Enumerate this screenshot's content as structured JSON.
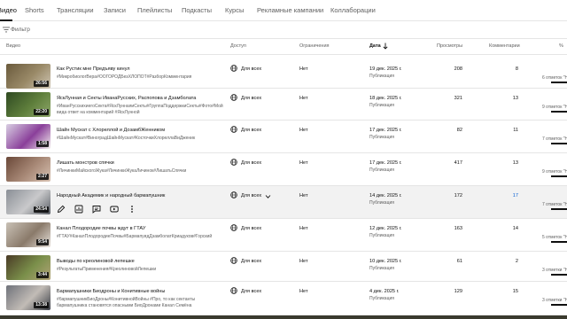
{
  "tabs": [
    "Видео",
    "Shorts",
    "Трансляции",
    "Записи",
    "Плейлисты",
    "Подкасты",
    "Курсы",
    "Рекламные кампании",
    "Коллаборации"
  ],
  "filter": {
    "label": "Фильтр",
    "icon": "filter-icon"
  },
  "columns": {
    "video": "Видео",
    "access": "Доступ",
    "restrictions": "Ограничения",
    "date": "Дата",
    "views": "Просмотры",
    "comments": "Комментарии",
    "likes": "% "
  },
  "rows": [
    {
      "title": "Как Рустик мне Предъяву кинул",
      "desc": "#МикробиологВера#ООГОРОДБезХЛОПОТ#РазборКомментария",
      "duration": "26:56",
      "access": "Для всех",
      "restrictions": "Нет",
      "date": "19 дек. 2025 г.",
      "status": "Публикация",
      "views": "208",
      "comments": "8",
      "likes": "6 отметок \"Н",
      "thumb_colors": [
        "#6a5a3c",
        "#9a8a68",
        "#cfc6b4"
      ]
    },
    {
      "title": "ЯскЛунная и Секты ИванаРусских, Распопова и Дзамболата",
      "desc": "#ИванРусскихиегоСекта#ЯскЛуннаяиСекты#ГруппаПоддержкиСекты#Фото#Мой вида ответ на комментарий #ЯскЛунной",
      "duration": "22:20",
      "access": "Для всех",
      "restrictions": "Нет",
      "date": "18 дек. 2025 г.",
      "status": "Публикация",
      "views": "321",
      "comments": "13",
      "likes": "9 отметок \"Н",
      "thumb_colors": [
        "#2f4a22",
        "#5f7f3c",
        "#8fa86a"
      ]
    },
    {
      "title": "Шайн Мускат с Хлореллой и ДозамбЖенником",
      "desc": "#ШайнМускат#ВиноградШайнМускат#КосточкиХлореллаВиДженик",
      "duration": "1:58",
      "access": "Для всех",
      "restrictions": "Нет",
      "date": "17 дек. 2025 г.",
      "status": "Публикация",
      "views": "82",
      "comments": "11",
      "likes": "7 отметок \"Н",
      "thumb_colors": [
        "#d9cfe3",
        "#8a3f9a",
        "#f4f0ee"
      ]
    },
    {
      "title": "Лишать монстров спячки",
      "desc": "#ЛичинкиМайскогоЖука#ЛичинкиЖукаЛичинок#ЛишатьСпячки",
      "duration": "2:27",
      "access": "Для всех",
      "restrictions": "Нет",
      "date": "17 дек. 2025 г.",
      "status": "Публикация",
      "views": "417",
      "comments": "13",
      "likes": "9 отметок \"Н",
      "thumb_colors": [
        "#6a4838",
        "#a98a78",
        "#d8c2b2"
      ]
    },
    {
      "title": "Народный Академик и народный бармапушник",
      "desc": "",
      "duration": "24:54",
      "access": "Для всех",
      "restrictions": "Нет",
      "date": "14 дек. 2025 г.",
      "status": "Публикация",
      "views": "172",
      "comments": "17",
      "likes": "7 отметок \"Н",
      "thumb_colors": [
        "#8a8f96",
        "#c9c9cb",
        "#5a5f66"
      ]
    },
    {
      "title": "Канал Плодородие почвы ждут в ГТАУ",
      "desc": "#ГТАУ#КаналПлодородиеПочвы#БармапуидДзамболатКриадуков#Горский",
      "duration": "9:54",
      "access": "Для всех",
      "restrictions": "Нет",
      "date": "12 дек. 2025 г.",
      "status": "Публикация",
      "views": "163",
      "comments": "14",
      "likes": "5 отметок \"Н",
      "thumb_colors": [
        "#c9c1b6",
        "#8a7a6a",
        "#e8e2dc"
      ]
    },
    {
      "title": "Выводы по креолиновой лепешке",
      "desc": "#РезультатыПрименения#КреолиновойЛепешки",
      "duration": "3:44",
      "access": "Для всех",
      "restrictions": "Нет",
      "date": "10 дек. 2025 г.",
      "status": "Публикация",
      "views": "61",
      "comments": "2",
      "likes": "3 отметки \"Н",
      "thumb_colors": [
        "#4a3a26",
        "#7a8f4a",
        "#b2a478"
      ]
    },
    {
      "title": "Бармапушники Биодроны и Конитивные войны",
      "desc": "#бармапушникБиоДроны#КонитивнойВойны #Про, то как сектанты бармапушника становятся опасными БиоДронами Канал Семёна",
      "duration": "13:38",
      "access": "Для всех",
      "restrictions": "Нет",
      "date": "4 дек. 2025 г.",
      "status": "Публикация",
      "views": "129",
      "comments": "15",
      "likes": "3 отметки \"Н",
      "thumb_colors": [
        "#6f727a",
        "#c2bcb6",
        "#3a3e46"
      ]
    }
  ],
  "hover_actions": [
    "edit-icon",
    "analytics-icon",
    "comments-icon",
    "youtube-icon",
    "more-icon"
  ],
  "colors": {
    "link": "#065fd4",
    "text": "#0f0f0f",
    "secondary": "#606060",
    "divider": "#e5e5e5",
    "hover": "#f2f2f2"
  }
}
